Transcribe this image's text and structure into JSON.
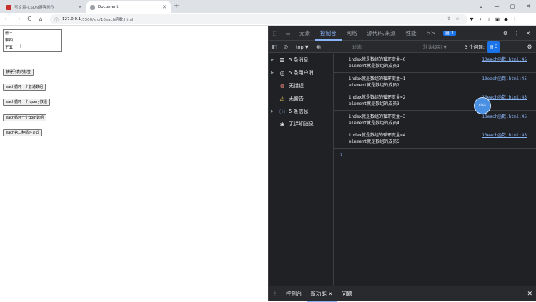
{
  "browser": {
    "tabs": [
      {
        "title": "写文章-CSDN博客创作",
        "favicon_color": "#c9302c",
        "active": false
      },
      {
        "title": "Document",
        "favicon_color": "#5f6368",
        "active": true
      }
    ],
    "new_tab": "+",
    "window_controls": [
      "⌄",
      "—",
      "▢",
      "✕"
    ],
    "nav": {
      "back": "←",
      "forward": "→",
      "reload": "C",
      "home": "⌂"
    },
    "url_info": "ⓘ",
    "url_host": "127.0.0.1",
    "url_rest": ":5500/src/10each函数.html",
    "omni_icons": [
      "⇪",
      "☆"
    ],
    "ext_icons": [
      "▼",
      "✦",
      "⁞",
      "▣",
      "●",
      "⋮"
    ]
  },
  "page": {
    "list_items": [
      "张三",
      "李四",
      "王五"
    ],
    "cursor_glyph": "I",
    "buttons": [
      "获得列表的标签",
      "each循环一个普通数组",
      "each循环一个jquery数组",
      "each循环一个dom数组",
      "each第二种循环方式"
    ]
  },
  "devtools": {
    "left_icons": [
      "⬚",
      "▭"
    ],
    "tabs": [
      "元素",
      "控制台",
      "网络",
      "源代码/来源",
      "性能",
      ">>"
    ],
    "selected_tab": "控制台",
    "issues_badge": "3",
    "right_icons": [
      "⚙",
      "⋮",
      "✕"
    ],
    "toolbar": {
      "sidebar_icon": "◧",
      "clear_icon": "⊘",
      "context": "top ▼",
      "eye_icon": "◉",
      "filter_placeholder": "过滤",
      "levels": "默认级别 ▼",
      "issues_label": "3 个问题:",
      "issues_count": "3",
      "settings_icon": "⚙"
    },
    "sidebar": [
      {
        "arrow": "▶",
        "icon": "☰",
        "icon_type": "plain",
        "label": "5 条消息"
      },
      {
        "arrow": "▶",
        "icon": "◎",
        "icon_type": "plain",
        "label": "5 条用户消..."
      },
      {
        "arrow": "",
        "icon": "⊗",
        "icon_type": "err",
        "label": "无错误"
      },
      {
        "arrow": "",
        "icon": "⚠",
        "icon_type": "warn",
        "label": "无警告"
      },
      {
        "arrow": "▶",
        "icon": "ⓘ",
        "icon_type": "info",
        "label": "5 条信息"
      },
      {
        "arrow": "",
        "icon": "✱",
        "icon_type": "plain",
        "label": "无详细消息"
      }
    ],
    "messages": [
      {
        "line1": "index就是数组的循环变量=0",
        "line2": "element就是数组的成员1",
        "source": "10each函数.html:45"
      },
      {
        "line1": "index就是数组的循环变量=1",
        "line2": "element就是数组的成员2",
        "source": "10each函数.html:45"
      },
      {
        "line1": "index就是数组的循环变量=2",
        "line2": "element就是数组的成员3",
        "source": "10each函数.html:45"
      },
      {
        "line1": "index就是数组的循环变量=3",
        "line2": "element就是数组的成员4",
        "source": "10each函数.html:45"
      },
      {
        "line1": "index就是数组的循环变量=4",
        "line2": "element就是数组的成员5",
        "source": "10each函数.html:45"
      }
    ],
    "prompt": "›",
    "click_indicator": "click",
    "drawer": {
      "menu": "⋮",
      "tabs": [
        "控制台",
        "新功能",
        "问题"
      ],
      "selected": "新功能",
      "tab_close": "✕",
      "close": "✕"
    }
  }
}
